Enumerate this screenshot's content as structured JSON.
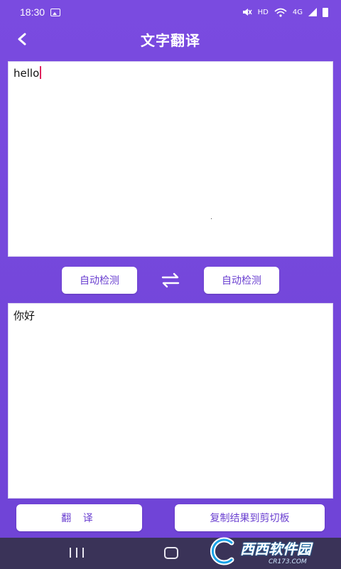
{
  "status_bar": {
    "time": "18:30",
    "indicators": "HD",
    "network": "4G"
  },
  "app_bar": {
    "title": "文字翻译"
  },
  "source": {
    "text": "hello"
  },
  "target": {
    "text": "你好"
  },
  "language": {
    "source_label": "自动检测",
    "target_label": "自动检测"
  },
  "actions": {
    "translate_label": "翻 译",
    "copy_label": "复制结果到剪切板"
  },
  "watermark": {
    "main": "西西软件园",
    "sub": "CR173.COM"
  },
  "colors": {
    "background": "#7648dc",
    "accent_text": "#6a3fd0",
    "nav_bar": "#3a3358"
  }
}
